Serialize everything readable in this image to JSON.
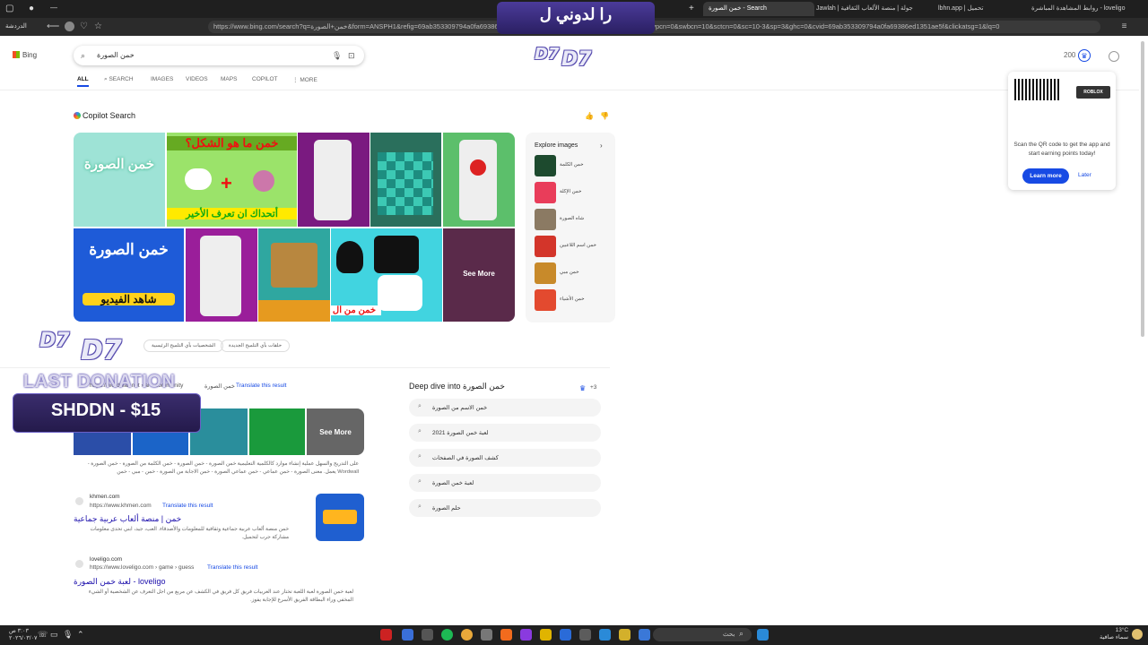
{
  "browser": {
    "tabs": [
      {
        "label": "روابط المشاهدة المباشرة - loveligo",
        "active": false
      },
      {
        "label": "lbhn.app | تحميل",
        "active": false
      },
      {
        "label": "Jawlah | جولة | منصة الألعاب الثقافية",
        "active": false
      },
      {
        "label": "خمن الصورة - Search",
        "active": true
      }
    ],
    "new_tab": "+",
    "address": "https://www.bing.com/search?q=خمن+الصورة&form=ANSPH1&refig=69ab353309794a0fa69386ed135...&pq=خمن+الصورة&qs=MT&sugtpv=MT&smvpcn=0&swbcn=10&sctcn=0&sc=10-3&sp=3&ghc=0&cvid=69ab353309794a0fa69386ed1351ae5f&clickatsg=1&lq=0",
    "left_label": "الدردشة"
  },
  "bing": {
    "logo_text": "Bing",
    "query": "خمن الصورة",
    "nav": [
      {
        "label": "ALL",
        "active": true
      },
      {
        "label": "SEARCH",
        "active": false
      },
      {
        "label": "IMAGES",
        "active": false
      },
      {
        "label": "VIDEOS",
        "active": false
      },
      {
        "label": "MAPS",
        "active": false
      },
      {
        "label": "COPILOT",
        "active": false
      },
      {
        "label": "MORE",
        "active": false
      }
    ],
    "rewards_points": "200"
  },
  "copilot": {
    "title": "Copilot Search",
    "thumb_texts": {
      "t1": "خمن الصورة",
      "t2_top": "خمن ما هو الشكل؟",
      "t2_bottom": "أتحداك ان تعرف الأخير",
      "t7_top": "خمن الصورة",
      "t7_bottom": "شاهد الفيديو",
      "t11": "خمن من ال"
    },
    "see_more": "See More",
    "explore_title": "Explore images",
    "explore_items": [
      "خمن الكلمة",
      "خمن الإكلة",
      "شاه الصورة",
      "خمن اسم اللاعبين",
      "خمن مبي",
      "خمن الأشياء"
    ]
  },
  "related_chips": [
    "حلقات بأي التلميح الجديدة",
    "الشخصيات بأي التلميح الرئيسية",
    "مع ..."
  ],
  "results": {
    "wordwall": {
      "site": "Wordwall",
      "url": "https://wordwall.net › ar › community",
      "heading_tail": "خمن الصورة",
      "translate": "Translate this result",
      "see_more": "See More",
      "snippet": "على التدريج والسهل عملية إنشاء موارد كالكلمية التعليمية خمن الصورة - خمن الصورة - خمن الكلمة من الصورة - خمن الصورة - Wordwall يعمل. معنى الصورة - خمن عماعي - خمن عماعي الصورة - خمن الاجابة من الصورة - خمن - مبي - خمن"
    },
    "khmen": {
      "site": "khmen.com",
      "url": "https://www.khmen.com",
      "translate": "Translate this result",
      "title": "خمن | منصة ألعاب عربية جماعية",
      "snippet": "خمن منصة ألعاب عربية جماعية وثقافية للمعلومات والأصدقاء. العب، جيد، ابني تحدى معلومات مشاركة جرب لتحميل."
    },
    "loveligo": {
      "site": "loveligo.com",
      "url": "https://www.loveligo.com › game › guess",
      "translate": "Translate this result",
      "title": "لعبة خمن الصورة - loveligo",
      "snippet": "لعبة خمن الصورة لعبة اللعبة تختار عند العربيات فريق كل فريق في الكشف عن مربع من اجل التعرف عن الشخصية أو الشيء المخفي وراء البطاقة الفريق الأسرع للإجابة يفوز."
    }
  },
  "deep_dive": {
    "title": "Deep dive into خمن الصورة",
    "badge": "+3",
    "items": [
      "خمن الاسم من الصورة",
      "لعبة خمن الصورة 2021",
      "كشف الصورة في الصفحات",
      "لعبة خمن الصورة",
      "حلم الصورة"
    ]
  },
  "promo_popup": {
    "brand": "ROBLOX",
    "message": "Scan the QR code to get the app and start earning points today!",
    "primary": "Learn more",
    "secondary": "Later"
  },
  "stream_overlay": {
    "top_banner": "را   لدوني   ل",
    "d7": "D7",
    "last_donation_label": "LAST DONATION",
    "last_donation_value": "SHDDN - $15"
  },
  "taskbar": {
    "search_placeholder": "بحث",
    "time": "٣:٠٣ ص",
    "date": "٢٠٢٦/٠٣/٠٧",
    "weather_temp": "13°C",
    "weather_desc": "سماء صافية"
  },
  "colors": {
    "accent": "#174ae4",
    "result_title": "#1a0dab",
    "overlay_purple": "#3a2d6d"
  }
}
